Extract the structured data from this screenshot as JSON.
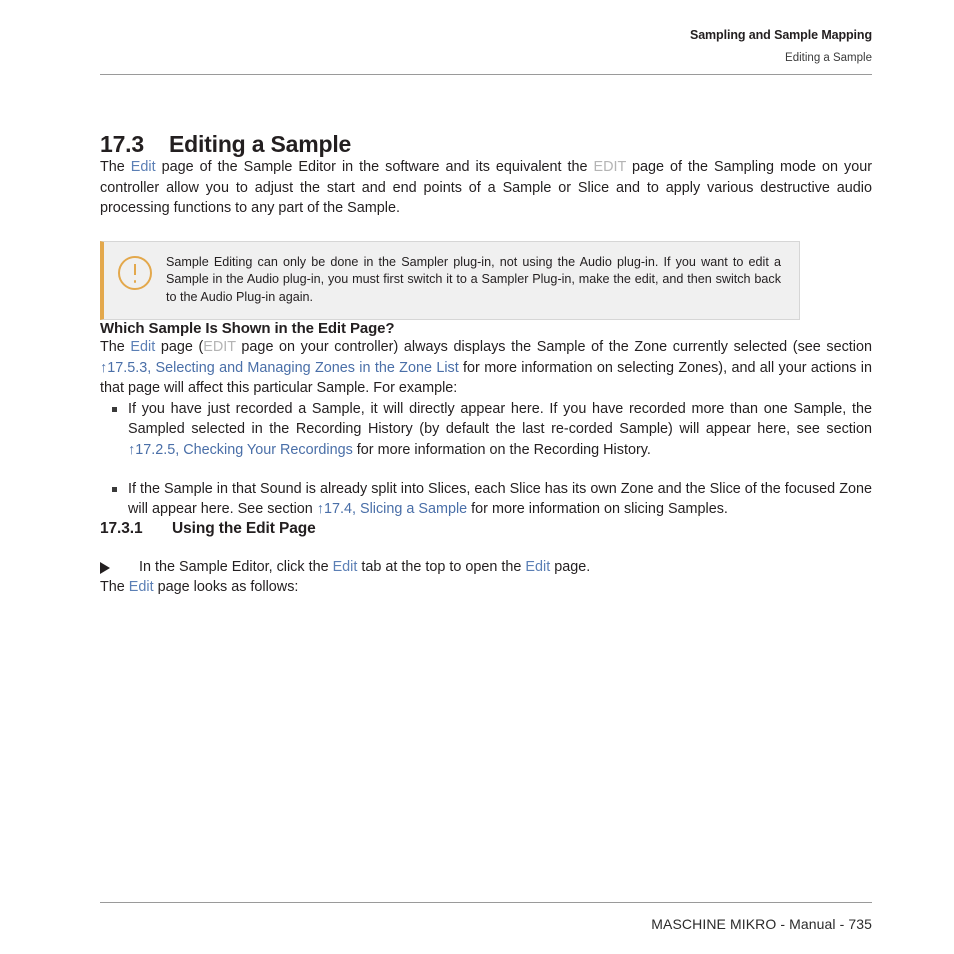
{
  "header": {
    "title": "Sampling and Sample Mapping",
    "subtitle": "Editing a Sample"
  },
  "chapter": {
    "number": "17.3",
    "title": "Editing a Sample"
  },
  "intro": {
    "t1": "The ",
    "sw1": "Edit",
    "t2": " page of the Sample Editor in the software and its equivalent the ",
    "hw1": "EDIT",
    "t3": " page of the Sampling mode on your controller allow you to adjust the start and end points of a Sample or Slice and to apply various destructive audio processing functions to any part of the Sample."
  },
  "callout": {
    "icon": "warning-circle-icon",
    "text": "Sample Editing can only be done in the Sampler plug-in, not using the Audio plug-in. If you want to edit a Sample in the Audio plug-in, you must first switch it to a Sampler Plug-in, make the edit, and then switch back to the Audio Plug-in again."
  },
  "section_which_sample": {
    "heading": "Which Sample Is Shown in the Edit Page?",
    "para": {
      "t1": "The ",
      "sw1": "Edit",
      "t2": " page (",
      "hw1": "EDIT",
      "t3": " page on your controller) always displays the Sample of the Zone currently selected (see section ",
      "xref1": "↑17.5.3, Selecting and Managing Zones in the Zone List",
      "t4": " for more information on selecting Zones), and all your actions in that page will affect this particular Sample. For example:"
    },
    "bullets": [
      {
        "t1": "If you have just recorded a Sample, it will directly appear here. If you have recorded more than one Sample, the Sampled selected in the Recording History (by default the last re-corded Sample) will appear here, see section ",
        "xref": "↑17.2.5, Checking Your Recordings",
        "t2": " for more information on the Recording History."
      },
      {
        "t1": "If the Sample in that Sound is already split into Slices, each Slice has its own Zone and the Slice of the focused Zone will appear here. See section ",
        "xref": "↑17.4, Slicing a Sample",
        "t2": " for more information on slicing Samples."
      }
    ]
  },
  "section_using_edit": {
    "number": "17.3.1",
    "heading": "Using the Edit Page",
    "step": {
      "t1": "In the Sample Editor, click the ",
      "sw1": "Edit",
      "t2": " tab at the top to open the ",
      "sw2": "Edit",
      "t3": " page."
    },
    "closing": {
      "t1": "The ",
      "sw1": "Edit",
      "t2": " page looks as follows:"
    }
  },
  "footer": {
    "text": "MASCHINE MIKRO - Manual - 735"
  },
  "colors": {
    "software_reference": "#5b7fb5",
    "hardware_reference": "#b4b4b4",
    "cross_reference": "#4a6fa8",
    "callout_accent": "#e3a84c",
    "callout_background": "#f0f0f0",
    "text": "#231f20"
  }
}
